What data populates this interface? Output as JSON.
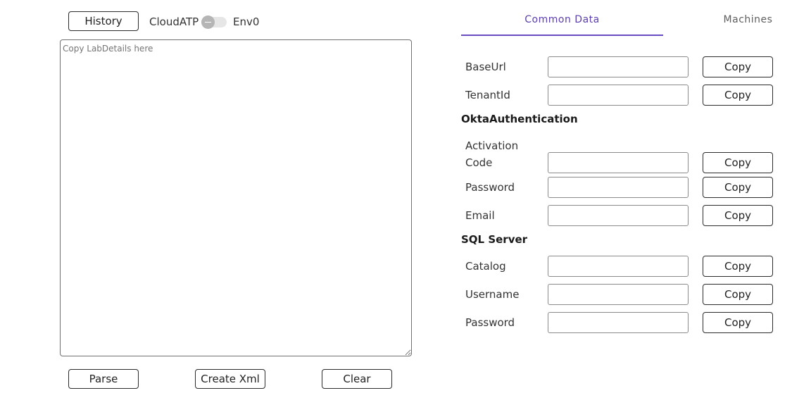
{
  "header": {
    "history_label": "History",
    "cloud_label": "CloudATP",
    "env_label": "Env0"
  },
  "editor": {
    "placeholder": "Copy LabDetails here",
    "value": ""
  },
  "actions": {
    "parse_label": "Parse",
    "create_xml_label": "Create Xml",
    "clear_label": "Clear"
  },
  "tabs": [
    {
      "label": "Common Data",
      "active": true
    },
    {
      "label": "Machines",
      "active": false
    }
  ],
  "form": {
    "copy_label": "Copy",
    "fields": {
      "base_url": {
        "label": "BaseUrl",
        "value": ""
      },
      "tenant_id": {
        "label": "TenantId",
        "value": ""
      },
      "activation_code": {
        "label_line1": "Activation",
        "label_line2": "Code",
        "value": ""
      },
      "okta_password": {
        "label": "Password",
        "value": ""
      },
      "email": {
        "label": "Email",
        "value": ""
      },
      "catalog": {
        "label": "Catalog",
        "value": ""
      },
      "username": {
        "label": "Username",
        "value": ""
      },
      "sql_password": {
        "label": "Password",
        "value": ""
      }
    },
    "sections": {
      "okta": "OktaAuthentication",
      "sql": "SQL Server"
    }
  },
  "colors": {
    "accent": "#6a4cc2",
    "active_tab_text": "#5b3fae",
    "toggle_knob": "#b5b5b5",
    "toggle_track": "#e6e6e6"
  },
  "icons": {
    "toggle": "toggle-switch-icon"
  }
}
